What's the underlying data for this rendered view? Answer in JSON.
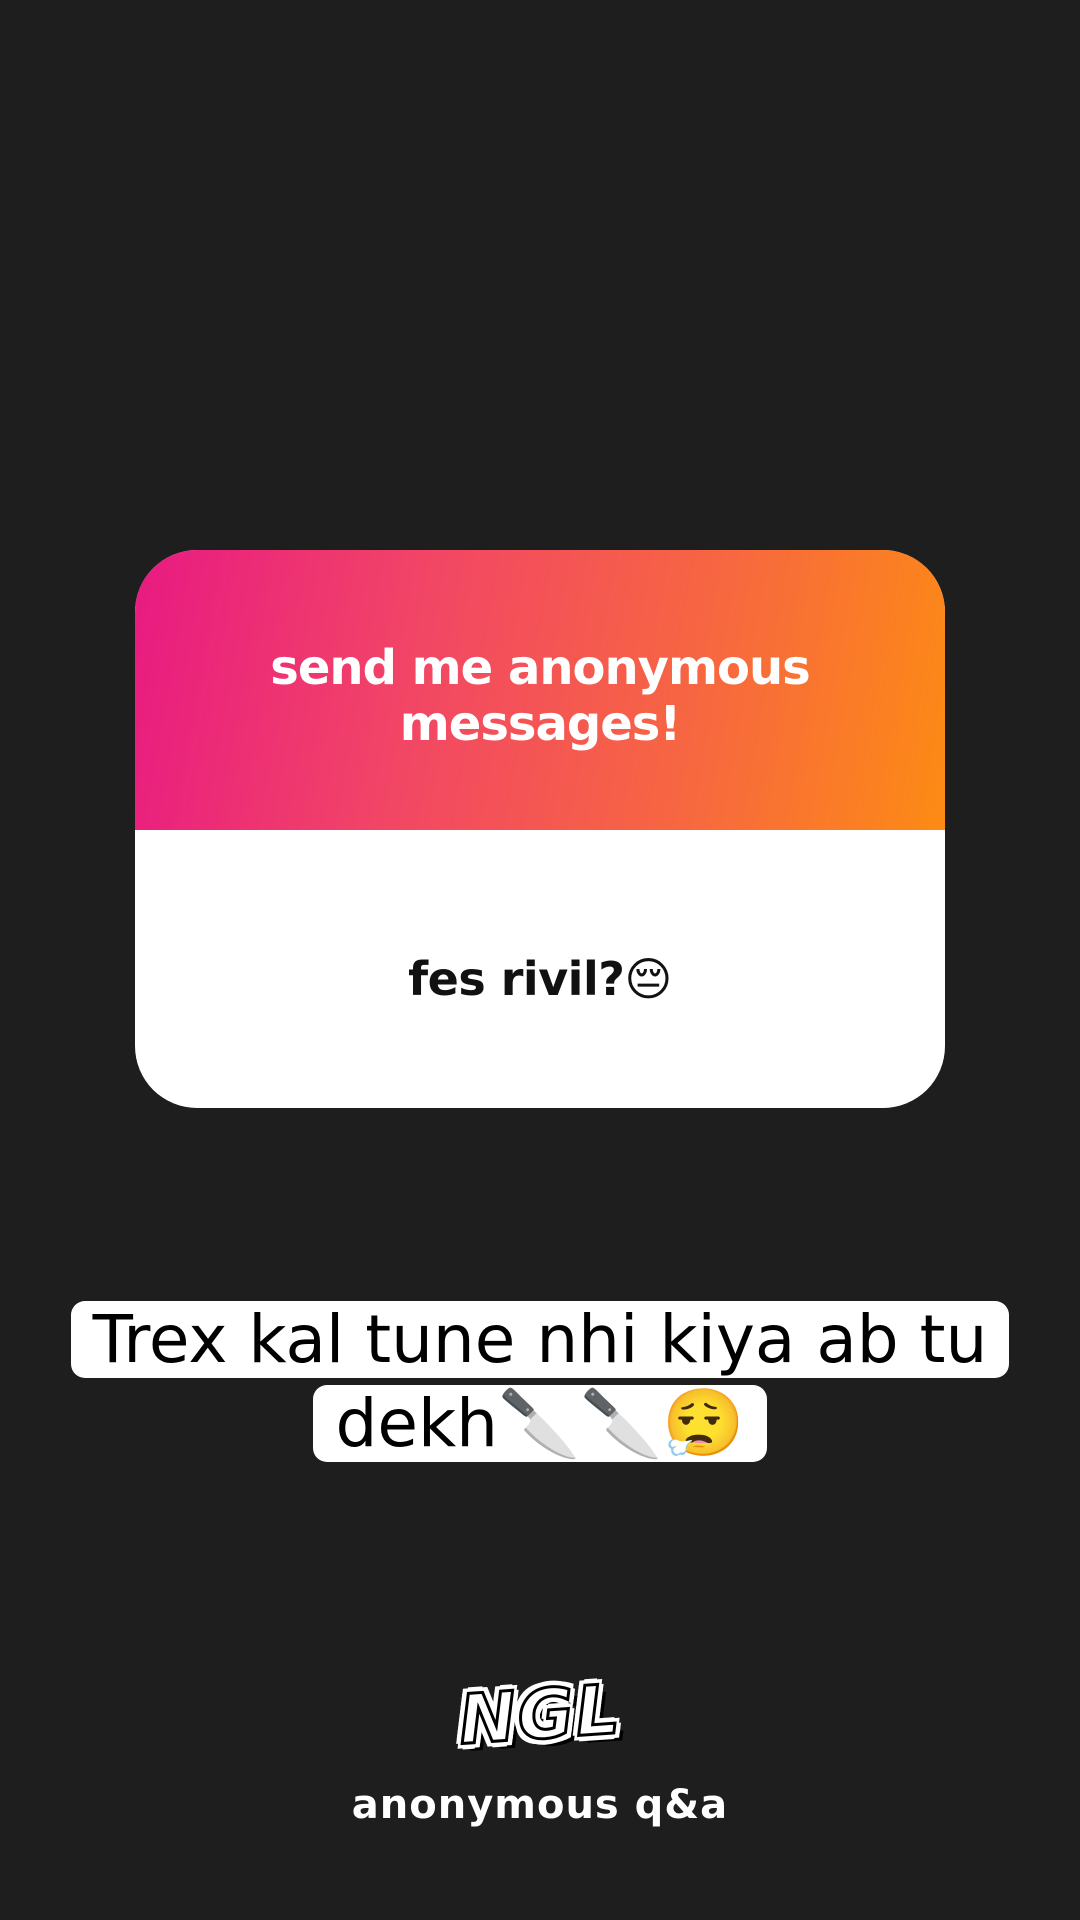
{
  "card": {
    "header_text": "send me anonymous messages!",
    "question": "fes rivil?😔",
    "gradient_colors": [
      "#e81a82",
      "#f24665",
      "#f7683f",
      "#fd8b14"
    ]
  },
  "reply": {
    "text": "Trex kal tune nhi kiya ab tu dekh🔪🔪😮‍💨"
  },
  "branding": {
    "logo_text": "NGL",
    "tagline": "anonymous q&a"
  },
  "colors": {
    "background": "#1e1e1e",
    "card_body": "#ffffff"
  }
}
